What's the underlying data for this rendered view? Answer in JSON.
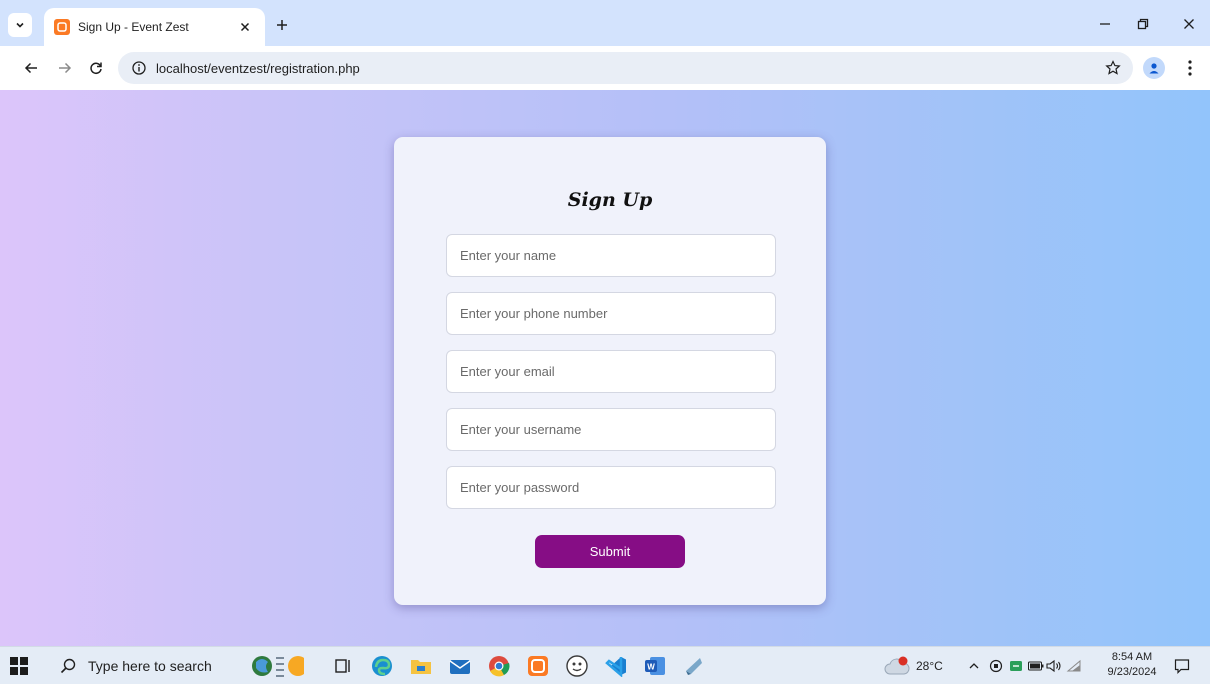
{
  "browser": {
    "tab_title": "Sign Up - Event Zest",
    "url": "localhost/eventzest/registration.php"
  },
  "page": {
    "title": "Sign Up",
    "fields": [
      {
        "name": "name",
        "placeholder": "Enter your name",
        "value": ""
      },
      {
        "name": "phone",
        "placeholder": "Enter your phone number",
        "value": ""
      },
      {
        "name": "email",
        "placeholder": "Enter your email",
        "value": ""
      },
      {
        "name": "username",
        "placeholder": "Enter your username",
        "value": ""
      },
      {
        "name": "password",
        "placeholder": "Enter your password",
        "value": ""
      }
    ],
    "submit_label": "Submit",
    "colors": {
      "submit_button": "#860d85",
      "gradient_left": "#dcc5fa",
      "gradient_right": "#92c4fb",
      "card": "#f0f2fb"
    }
  },
  "taskbar": {
    "search_placeholder": "Type here to search",
    "weather": {
      "temperature": "28°C",
      "alert_badge": "1"
    },
    "clock": {
      "time": "8:54 AM",
      "date": "9/23/2024"
    },
    "apps": [
      "widgets-icon",
      "task-view-icon",
      "edge-icon",
      "file-explorer-icon",
      "mail-icon",
      "chrome-icon",
      "xampp-icon",
      "dev-app-icon",
      "vscode-icon",
      "word-icon",
      "misc-app-icon"
    ]
  }
}
